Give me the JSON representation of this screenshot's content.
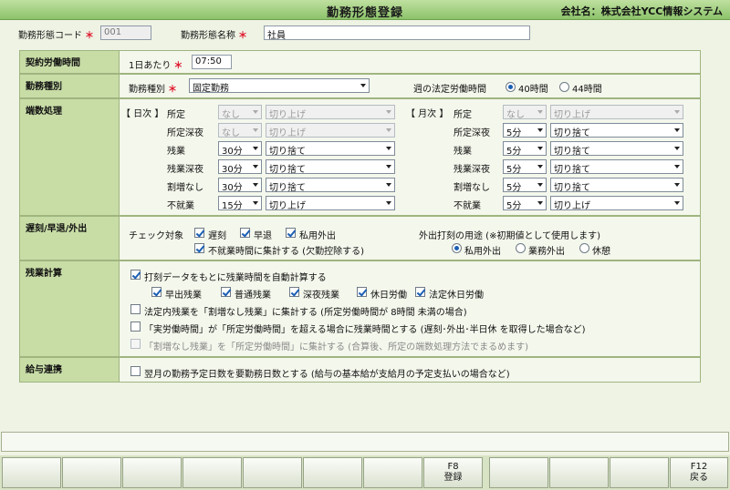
{
  "window": {
    "title": "勤務形態登録",
    "company": "会社名：株式会社YCC情報システム"
  },
  "header": {
    "code_label": "勤務形態コード",
    "code_value": "001",
    "name_label": "勤務形態名称",
    "name_value": "社員",
    "required_mark": "＊"
  },
  "contract": {
    "section": "契約労働時間",
    "per_day_label": "1日あたり",
    "time_value": "07:50"
  },
  "work_type": {
    "section": "勤務種別",
    "label": "勤務種別",
    "value": "固定勤務",
    "legal_label": "週の法定労働時間",
    "opt40": "40時間",
    "opt44": "44時間"
  },
  "rounding": {
    "section": "端数処理",
    "daily_label": "【 日次 】",
    "monthly_label": "【 月次 】",
    "daily_rows": [
      {
        "label": "所定",
        "unit": "なし",
        "method": "切り上げ",
        "disabled": true
      },
      {
        "label": "所定深夜",
        "unit": "なし",
        "method": "切り上げ",
        "disabled": true
      },
      {
        "label": "残業",
        "unit": "30分",
        "method": "切り捨て",
        "disabled": false
      },
      {
        "label": "残業深夜",
        "unit": "30分",
        "method": "切り捨て",
        "disabled": false
      },
      {
        "label": "割増なし",
        "unit": "30分",
        "method": "切り捨て",
        "disabled": false
      },
      {
        "label": "不就業",
        "unit": "15分",
        "method": "切り上げ",
        "disabled": false
      }
    ],
    "monthly_rows": [
      {
        "label": "所定",
        "unit": "なし",
        "method": "切り上げ",
        "disabled": true
      },
      {
        "label": "所定深夜",
        "unit": "5分",
        "method": "切り捨て",
        "disabled": false
      },
      {
        "label": "残業",
        "unit": "5分",
        "method": "切り捨て",
        "disabled": false
      },
      {
        "label": "残業深夜",
        "unit": "5分",
        "method": "切り捨て",
        "disabled": false
      },
      {
        "label": "割増なし",
        "unit": "5分",
        "method": "切り捨て",
        "disabled": false
      },
      {
        "label": "不就業",
        "unit": "5分",
        "method": "切り上げ",
        "disabled": false
      }
    ]
  },
  "late": {
    "section": "遅刻/早退/外出",
    "check_target_label": "チェック対象",
    "chk_late": "遅刻",
    "chk_early": "早退",
    "chk_private": "私用外出",
    "chk_nonwork": "不就業時間に集計する (欠勤控除する)",
    "purpose_label": "外出打刻の用途 (※初期値として使用します)",
    "opt_private": "私用外出",
    "opt_business": "業務外出",
    "opt_break": "休憩"
  },
  "overtime": {
    "section": "残業計算",
    "auto_calc": "打刻データをもとに残業時間を自動計算する",
    "early": "早出残業",
    "normal": "普通残業",
    "night": "深夜残業",
    "holiday": "休日労働",
    "legal_holiday": "法定休日労働",
    "opt1": "法定内残業を「割増なし残業」に集計する (所定労働時間が 8時間 未満の場合)",
    "opt2": "「実労働時間」が「所定労働時間」を超える場合に残業時間とする (遅刻･外出･半日休 を取得した場合など)",
    "opt3": "「割増なし残業」を「所定労働時間」に集計する (合算後、所定の端数処理方法でまるめます)"
  },
  "salary": {
    "section": "給与連携",
    "opt": "翌月の勤務予定日数を要勤務日数とする (給与の基本給が支給月の予定支払いの場合など)"
  },
  "fkeys": {
    "f8_key": "F8",
    "f8_label": "登録",
    "f12_key": "F12",
    "f12_label": "戻る"
  }
}
